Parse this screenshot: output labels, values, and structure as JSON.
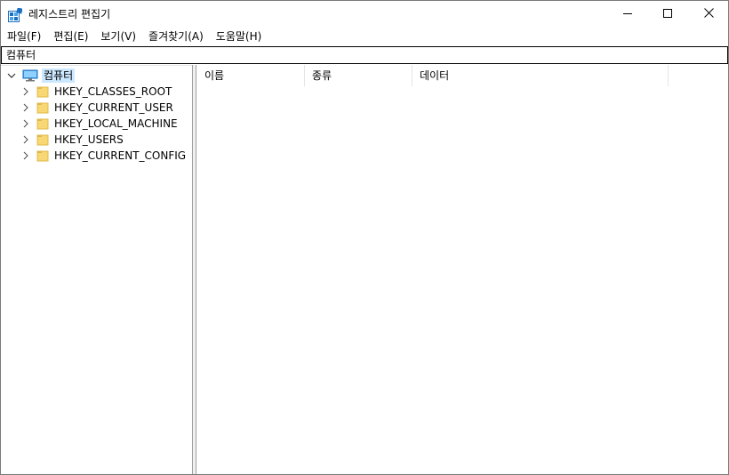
{
  "window": {
    "title": "레지스트리 편집기",
    "controls": {
      "minimize": "minimize",
      "maximize": "maximize",
      "close": "close"
    }
  },
  "menu": [
    "파일(F)",
    "편집(E)",
    "보기(V)",
    "즐겨찾기(A)",
    "도움말(H)"
  ],
  "address": {
    "value": "컴퓨터"
  },
  "tree": {
    "root": {
      "label": "컴퓨터",
      "expanded": true,
      "selected": true,
      "icon": "computer-icon"
    },
    "children": [
      {
        "label": "HKEY_CLASSES_ROOT",
        "icon": "folder-icon"
      },
      {
        "label": "HKEY_CURRENT_USER",
        "icon": "folder-icon"
      },
      {
        "label": "HKEY_LOCAL_MACHINE",
        "icon": "folder-icon"
      },
      {
        "label": "HKEY_USERS",
        "icon": "folder-icon"
      },
      {
        "label": "HKEY_CURRENT_CONFIG",
        "icon": "folder-icon"
      }
    ]
  },
  "list": {
    "columns": [
      "이름",
      "종류",
      "데이터"
    ],
    "rows": []
  },
  "colors": {
    "selection": "#cce8ff",
    "folder": "#f8d775",
    "folder_edge": "#e0b84a",
    "app_icon": "#1b6fc2",
    "border": "#7a7a7a"
  }
}
